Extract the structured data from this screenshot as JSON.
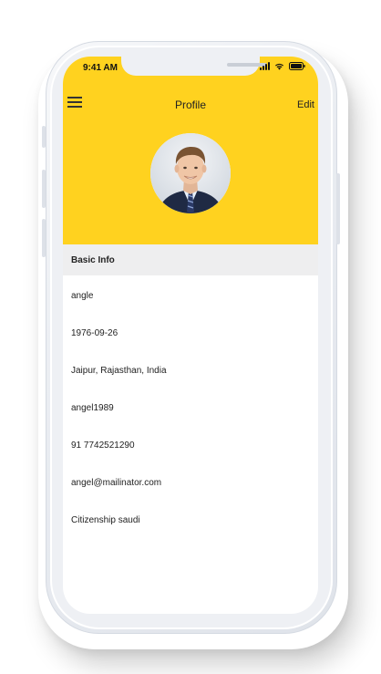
{
  "status_bar": {
    "time": "9:41 AM",
    "icons": [
      "signal-icon",
      "wifi-icon",
      "battery-icon"
    ]
  },
  "header": {
    "title": "Profile",
    "edit_label": "Edit",
    "menu_icon": "hamburger-menu-icon",
    "avatar_icon": "profile-photo"
  },
  "section": {
    "title": "Basic Info"
  },
  "info": {
    "items": [
      {
        "label": "angle"
      },
      {
        "label": "1976-09-26"
      },
      {
        "label": "Jaipur, Rajasthan, India"
      },
      {
        "label": "angel1989"
      },
      {
        "label": "91 7742521290"
      },
      {
        "label": "angel@mailinator.com"
      },
      {
        "label": "Citizenship saudi"
      }
    ]
  },
  "colors": {
    "accent": "#ffd21f",
    "section_bg": "#eeeeef",
    "text": "#222222"
  }
}
